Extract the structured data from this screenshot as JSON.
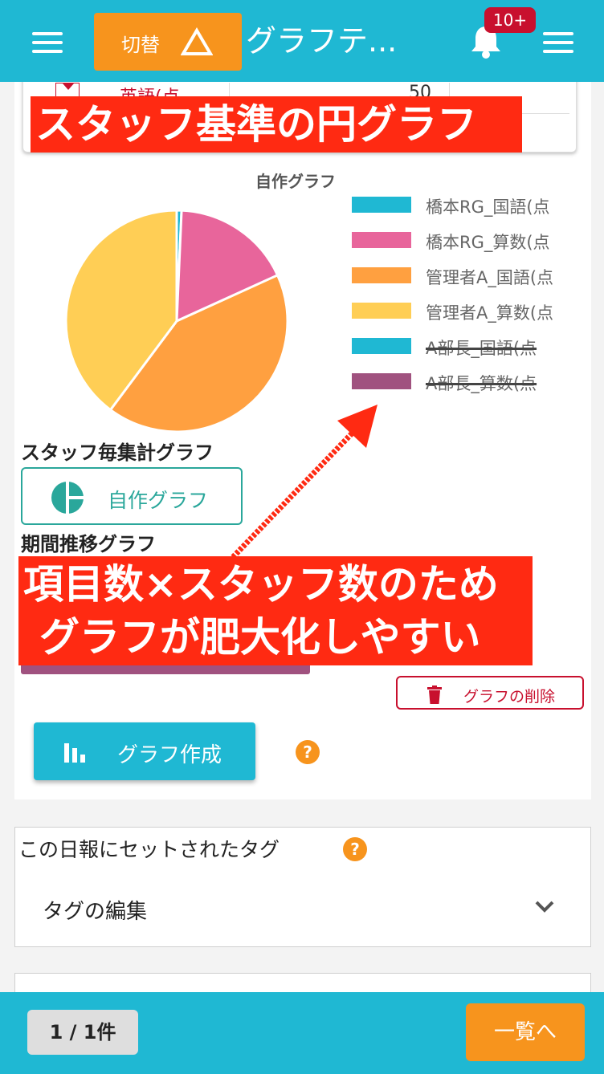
{
  "header": {
    "switch_label": "切替",
    "title": "グラフテ...",
    "notification_count": "10+"
  },
  "table_fragment": {
    "row_label": "英語(点",
    "row_value": "50"
  },
  "annotations": {
    "banner_top": "スタッフ基準の円グラフ",
    "banner_bottom_line1": "項目数×スタッフ数のため",
    "banner_bottom_line2": "グラフが肥大化しやすい"
  },
  "chart_data": {
    "type": "pie",
    "title": "自作グラフ",
    "series": [
      {
        "name": "橋本RG_国語(点",
        "value": 0.7,
        "color": "#1fb8d3",
        "visible": true
      },
      {
        "name": "橋本RG_算数(点",
        "value": 17.5,
        "color": "#e8659b",
        "visible": true
      },
      {
        "name": "管理者A_国語(点",
        "value": 42.0,
        "color": "#ffa040",
        "visible": true
      },
      {
        "name": "管理者A_算数(点",
        "value": 39.8,
        "color": "#ffce55",
        "visible": true
      },
      {
        "name": "A部長_国語(点",
        "value": 0,
        "color": "#1fb8d3",
        "visible": false
      },
      {
        "name": "A部長_算数(点",
        "value": 0,
        "color": "#a0527f",
        "visible": false
      }
    ],
    "legend_position": "right"
  },
  "sections": {
    "staff_graph_label": "スタッフ毎集計グラフ",
    "custom_graph_button": "自作グラフ",
    "period_graph_label": "期間推移グラフ"
  },
  "actions": {
    "delete_graph": "グラフの削除",
    "create_graph": "グラフ作成"
  },
  "tags": {
    "title": "この日報にセットされたタグ",
    "edit_label": "タグの編集"
  },
  "footer": {
    "page_count": "1 / 1件",
    "list_button": "一覧へ"
  }
}
